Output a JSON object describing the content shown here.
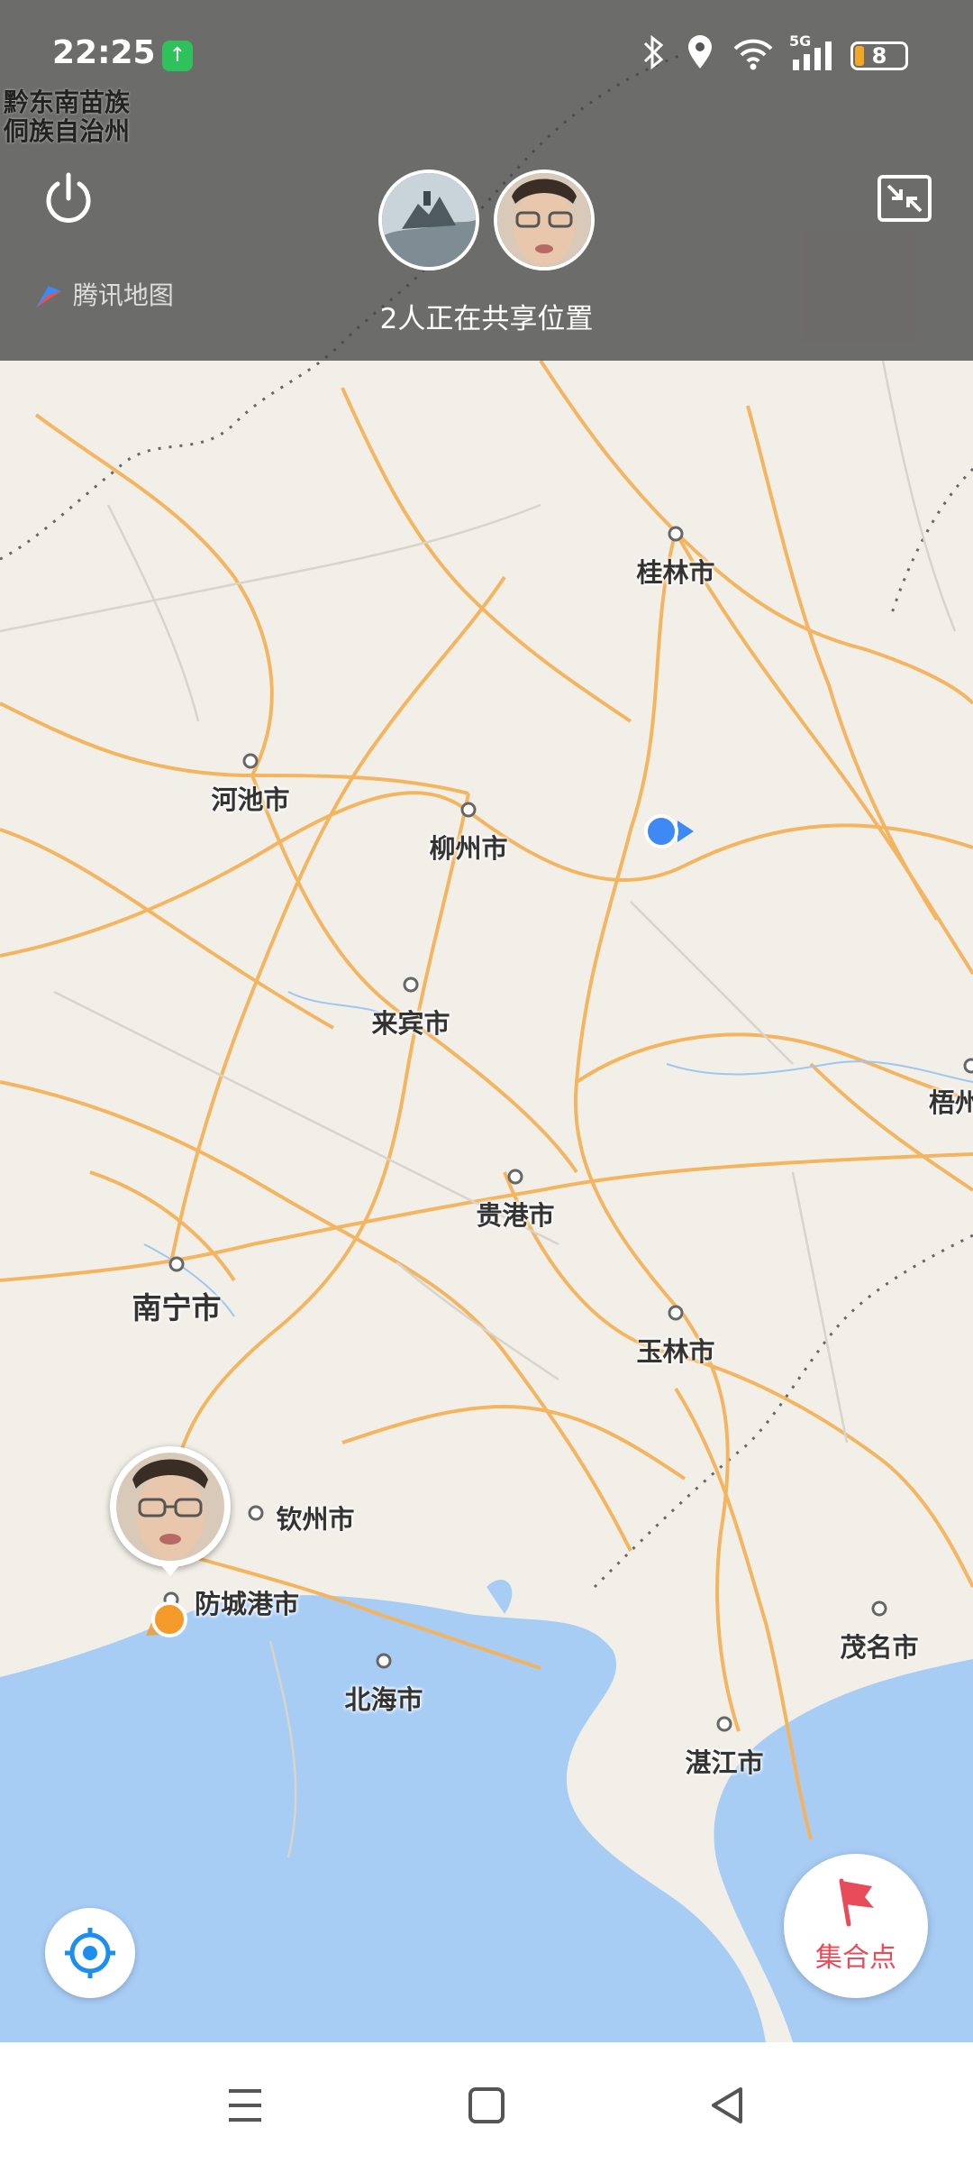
{
  "status_bar": {
    "time": "22:25",
    "network": "5G",
    "battery": "8",
    "icons": [
      "upload-icon",
      "bluetooth-icon",
      "location-icon",
      "wifi-icon",
      "signal-icon",
      "battery-icon"
    ]
  },
  "overlay": {
    "region_label_line1": "黔东南苗族",
    "region_label_line2": "侗族自治州",
    "map_provider": "腾讯地图",
    "share_status": "2人正在共享位置"
  },
  "map": {
    "cities": [
      {
        "id": "guilin",
        "name": "桂林市"
      },
      {
        "id": "hechi",
        "name": "河池市"
      },
      {
        "id": "liuzhou",
        "name": "柳州市"
      },
      {
        "id": "laibin",
        "name": "来宾市"
      },
      {
        "id": "wuzhou",
        "name": "梧州"
      },
      {
        "id": "guigang",
        "name": "贵港市"
      },
      {
        "id": "nanning",
        "name": "南宁市"
      },
      {
        "id": "yulin",
        "name": "玉林市"
      },
      {
        "id": "qinzhou",
        "name": "钦州市"
      },
      {
        "id": "fangchenggang",
        "name": "防城港市"
      },
      {
        "id": "beihai",
        "name": "北海市"
      },
      {
        "id": "maoming",
        "name": "茂名市"
      },
      {
        "id": "zhanjiang",
        "name": "湛江市"
      }
    ]
  },
  "buttons": {
    "rally_point": "集合点"
  },
  "colors": {
    "road": "#f5b25a",
    "water": "#a8cdf5",
    "land": "#f2efe9",
    "self_marker": "#3d8af7",
    "peer_marker": "#f39a2b",
    "rally_accent": "#e84c5b"
  }
}
